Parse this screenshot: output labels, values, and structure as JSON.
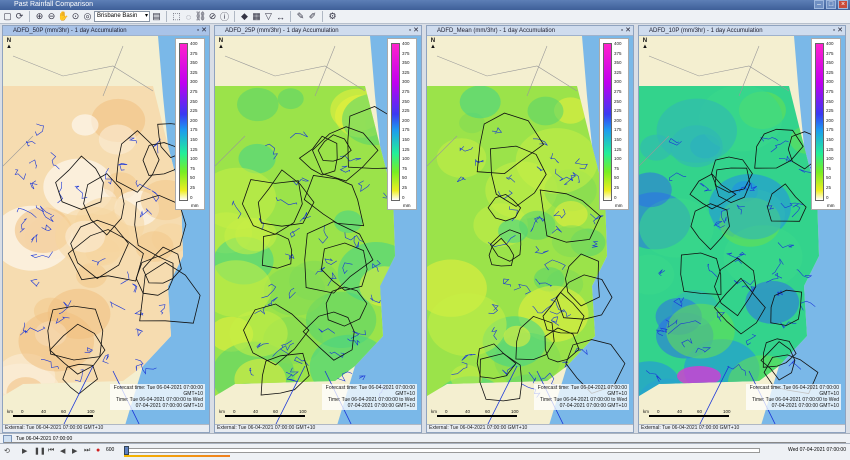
{
  "window": {
    "title": "Past Rainfall Comparison"
  },
  "toolbar": {
    "basin_value": "Brisbane Basin"
  },
  "panels": [
    {
      "title": "ADFD_50P (mm/3hr) - 1 day Accumulation",
      "theme": "orange"
    },
    {
      "title": "ADFD_25P (mm/3hr) - 1 day Accumulation",
      "theme": "green"
    },
    {
      "title": "ADFD_Mean (mm/3hr) - 1 day Accumulation",
      "theme": "green"
    },
    {
      "title": "ADFD_10P (mm/3hr) - 1 day Accumulation",
      "theme": "blue"
    }
  ],
  "legend": {
    "ticks": [
      "400",
      "375",
      "350",
      "325",
      "300",
      "275",
      "250",
      "225",
      "200",
      "175",
      "150",
      "125",
      "100",
      "75",
      "50",
      "25",
      "0"
    ],
    "unit": "mm"
  },
  "overlay": {
    "north": "N",
    "forecast_label": "Forecast time: Tue 06-04-2021 07:00:00",
    "forecast_tz": "GMT+10",
    "time_label": "Time: Tue 06-04-2021 07:00:00 to Wed",
    "time_label2": "07-04-2021 07:00:00 GMT+10",
    "scale_ticks": [
      "km",
      "0",
      "40",
      "60",
      "100"
    ]
  },
  "external": "External: Tue 06-04-2021 07:00:00 GMT+10",
  "timeline": {
    "left": "Tue 06-04-2021 07:00:00",
    "right": "Wed 07-04-2021 07:00:00",
    "speed": "600"
  },
  "colors": {
    "accent": "#5c7fc0",
    "ocean": "#7ab8e8",
    "land": "#f4efd0"
  }
}
